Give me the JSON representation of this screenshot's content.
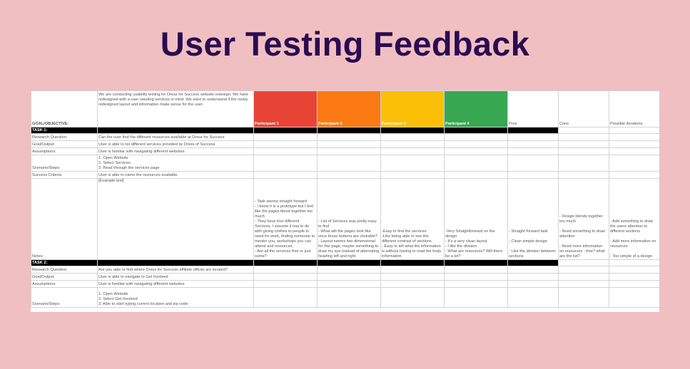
{
  "title": "User Testing Feedback",
  "colors": {
    "background": "#f0bfc1",
    "title": "#2b0a52",
    "participant_1": "#e84436",
    "participant_2": "#fb7a14",
    "participant_3": "#fcbf08",
    "participant_4": "#37a752"
  },
  "header": {
    "goal_label": "GOAL/OBJECTIVE:",
    "goal_text": "We are conducting usability testing for Dress for Success website redesign.  We have redesigned with a user needing services in mind.  We want to understand if the newly redesigned layout and information make sense for the user.",
    "participants": [
      "Participant 1",
      "Participant 2",
      "Participant 3",
      "Participant 4"
    ],
    "pros": "Pros",
    "cons": "Cons",
    "possible_iterations": "Possible iterations"
  },
  "task1": {
    "label": "TASK 1:",
    "rows": [
      {
        "label": "Research Question:",
        "value": "Can the user find the different resources available at Dress for Success"
      },
      {
        "label": "Goal/Output:",
        "value": "User is able to list different services provided by Dress of Success"
      },
      {
        "label": "Assumptions:",
        "value": "User is familiar with navigating different websites"
      },
      {
        "label": "Scenario/Steps:",
        "value": "1. Open Website\n2. Select Services\n3. Read through the services page"
      },
      {
        "label": "Success Criteria:",
        "value": "User is able to name the resources available."
      }
    ],
    "notes": {
      "label": "Notes:",
      "value": "[Example text]",
      "participant_1": "- Task seems straight forward\n- I know it is a prototype but I feel like the pages blend together too much\n- They have four different Services, I assume it has to do with giving clothes to people in need for work, finding someone to mentor you, workshops you can attend and resources.\n- Are all the services free or just some?",
      "participant_2": "- List of Services was pretty easy to find\n- What will the pages look like once those buttons are clickable?\n- Layout seems two dimensional for this page, maybe something to draw my eye instead of alternating heading left and right",
      "participant_3": "-Easy to find the services\n-Like being able to see the different contrast of sections\n- Easy to tell what the information is without having to read the body information",
      "participant_4": "-Very Straightforward on the design\n- It's a very clean layout\n- I like the division\n- What are resources? Will there be a lot?",
      "pros": "- Straight forward task\n\n- Clean simple design\n\n- Like the division between sections",
      "cons": "- Design blends together too much\n\n- Need something to draw attention\n\n- Need more information on resources - free? what are the list?",
      "iterations": "- Add something to draw the users attention to different sections\n\n- Add more information on resources\n\n- Too simple of a design"
    }
  },
  "task2": {
    "label": "TASK 2:",
    "rows": [
      {
        "label": "Research Question:",
        "value": "Are you able to find where Dress for Success affiliate offices are located?"
      },
      {
        "label": "Goal/Output:",
        "value": "User is able to navigate to Get Involved"
      },
      {
        "label": "Assumptions:",
        "value": "User is familiar with navigating different websites"
      },
      {
        "label": "Scenario/Steps:",
        "value": "1. Open Website\n2. Select Get Involved\n3. Able to start typing current location and zip code"
      }
    ]
  }
}
